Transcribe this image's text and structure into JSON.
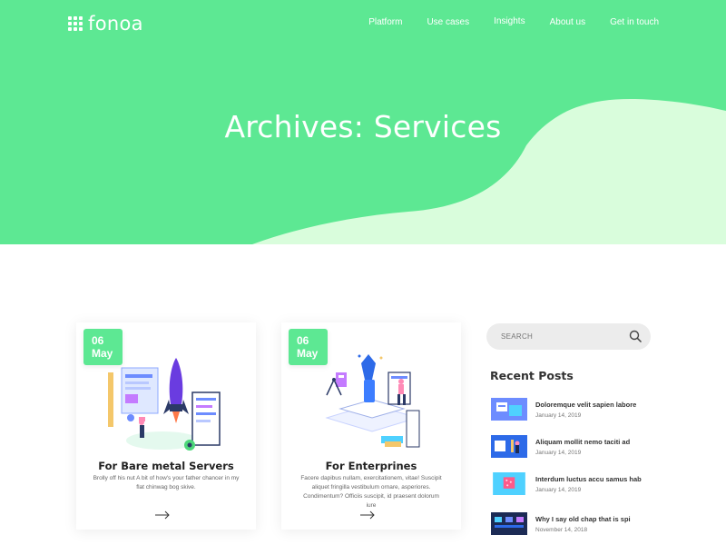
{
  "brand": {
    "name": "fonoa"
  },
  "nav": [
    {
      "label": "Platform"
    },
    {
      "label": "Use cases"
    },
    {
      "label": "Insights"
    },
    {
      "label": "About us"
    },
    {
      "label": "Get in touch"
    }
  ],
  "hero": {
    "title": "Archives: Services"
  },
  "cards": [
    {
      "day": "06",
      "month": "May",
      "title": "For Bare metal Servers",
      "text": "Brolly off his nut A bit of how's your father chancer in my flat chinwag bog skive."
    },
    {
      "day": "06",
      "month": "May",
      "title": "For Enterprines",
      "text": "Facere dapibus nullam, exercitationem, vitae! Suscipit aliquet fringilla vestibulum ornare, asperiores. Condimentum? Officiis suscipit, id praesent dolorum iure"
    }
  ],
  "sidebar": {
    "search_placeholder": "SEARCH",
    "recent_title": "Recent Posts",
    "posts": [
      {
        "title": "Doloremque velit sapien labore",
        "date": "January 14, 2019"
      },
      {
        "title": "Aliquam mollit nemo taciti ad",
        "date": "January 14, 2019"
      },
      {
        "title": "Interdum luctus accu samus hab",
        "date": "January 14, 2019"
      },
      {
        "title": "Why I say old chap that is spi",
        "date": "November 14, 2018"
      }
    ]
  },
  "colors": {
    "accent": "#5de893",
    "wave": "#d9fddc"
  }
}
